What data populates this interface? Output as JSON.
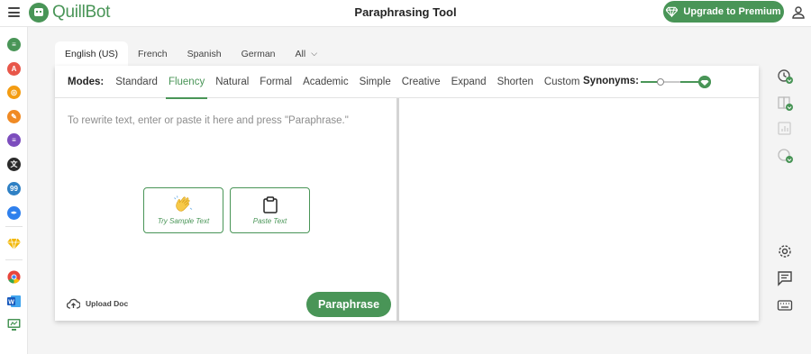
{
  "header": {
    "brand": "QuillBot",
    "title": "Paraphrasing Tool",
    "upgrade_label": "Upgrade to Premium"
  },
  "sidebar": {
    "apps": [
      {
        "name": "paraphraser-app-icon",
        "color": "#499557",
        "glyph": "≡"
      },
      {
        "name": "grammar-checker-app-icon",
        "color": "#e8574a",
        "glyph": "A"
      },
      {
        "name": "plagiarism-checker-app-icon",
        "color": "#f39c12",
        "glyph": "◎"
      },
      {
        "name": "co-writer-app-icon",
        "color": "#f08a24",
        "glyph": "✎"
      },
      {
        "name": "summarizer-app-icon",
        "color": "#7c4dbd",
        "glyph": "≡"
      },
      {
        "name": "translator-app-icon",
        "color": "#2b2b2b",
        "glyph": "文"
      },
      {
        "name": "citation-generator-app-icon",
        "color": "#2f80c4",
        "glyph": "99"
      },
      {
        "name": "flow-app-icon",
        "color": "#2f80ed",
        "glyph": "✒"
      }
    ],
    "premium_icon": {
      "name": "premium-diamond-icon",
      "color": "#f2b705"
    },
    "extensions": [
      {
        "name": "chrome-extension-icon"
      },
      {
        "name": "word-extension-icon"
      },
      {
        "name": "desktop-app-icon"
      }
    ]
  },
  "languages": {
    "tabs": [
      "English (US)",
      "French",
      "Spanish",
      "German",
      "All"
    ],
    "active": "English (US)"
  },
  "modes": {
    "label": "Modes:",
    "items": [
      "Standard",
      "Fluency",
      "Natural",
      "Formal",
      "Academic",
      "Simple",
      "Creative",
      "Expand",
      "Shorten",
      "Custom"
    ],
    "active": "Fluency"
  },
  "synonyms": {
    "label": "Synonyms:",
    "level": 0.25
  },
  "input": {
    "placeholder": "To rewrite text, enter or paste it here and press \"Paraphrase.\"",
    "sample_label": "Try Sample Text",
    "paste_label": "Paste Text",
    "upload_label": "Upload Doc",
    "paraphrase_label": "Paraphrase"
  },
  "colors": {
    "accent": "#499557"
  }
}
